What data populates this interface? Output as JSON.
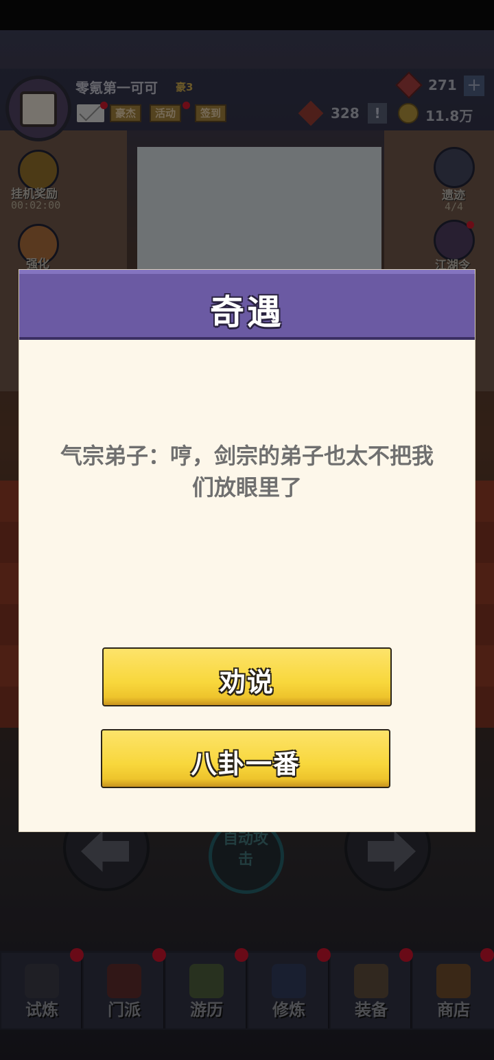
{
  "header": {
    "player_name": "零氪第一可可",
    "vip_label": "豪3",
    "buttons": [
      "豪杰",
      "活动",
      "签到"
    ],
    "gems": "271",
    "plus": "+",
    "tokens": "328",
    "exclaim": "!",
    "coins": "11.8万"
  },
  "side_left": [
    {
      "label": "挂机奖励",
      "sub": "00:02:00"
    },
    {
      "label": "强化"
    }
  ],
  "side_right": [
    {
      "label": "遗迹",
      "sub": "4/4"
    },
    {
      "label": "江湖令"
    }
  ],
  "controls": {
    "auto_attack": "自动攻击"
  },
  "bottom_nav": [
    {
      "label": "试炼"
    },
    {
      "label": "门派"
    },
    {
      "label": "游历"
    },
    {
      "label": "修炼"
    },
    {
      "label": "装备"
    },
    {
      "label": "商店"
    }
  ],
  "dialog": {
    "title": "奇遇",
    "message": "气宗弟子：哼，剑宗的弟子也太不把我们放眼里了",
    "choices": [
      "劝说",
      "八卦一番"
    ]
  },
  "colors": {
    "dialog_header": "#6b5aa3",
    "dialog_body": "#fdf7ea",
    "button_yellow": "#f8d73c"
  }
}
